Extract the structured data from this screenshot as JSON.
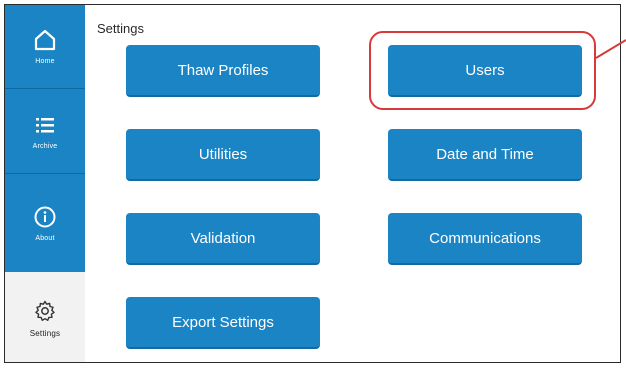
{
  "page": {
    "title": "Settings"
  },
  "sidebar": {
    "items": [
      {
        "label": "Home",
        "icon": "home-icon"
      },
      {
        "label": "Archive",
        "icon": "list-icon"
      },
      {
        "label": "About",
        "icon": "info-icon"
      },
      {
        "label": "Settings",
        "icon": "gear-icon",
        "active": true
      }
    ]
  },
  "buttons": {
    "thaw_profiles": "Thaw Profiles",
    "users": "Users",
    "utilities": "Utilities",
    "date_and_time": "Date and Time",
    "validation": "Validation",
    "communications": "Communications",
    "export_settings": "Export Settings"
  },
  "colors": {
    "accent": "#1a84c4",
    "highlight": "#d63a3a",
    "active_bg": "#f2f2f2"
  }
}
